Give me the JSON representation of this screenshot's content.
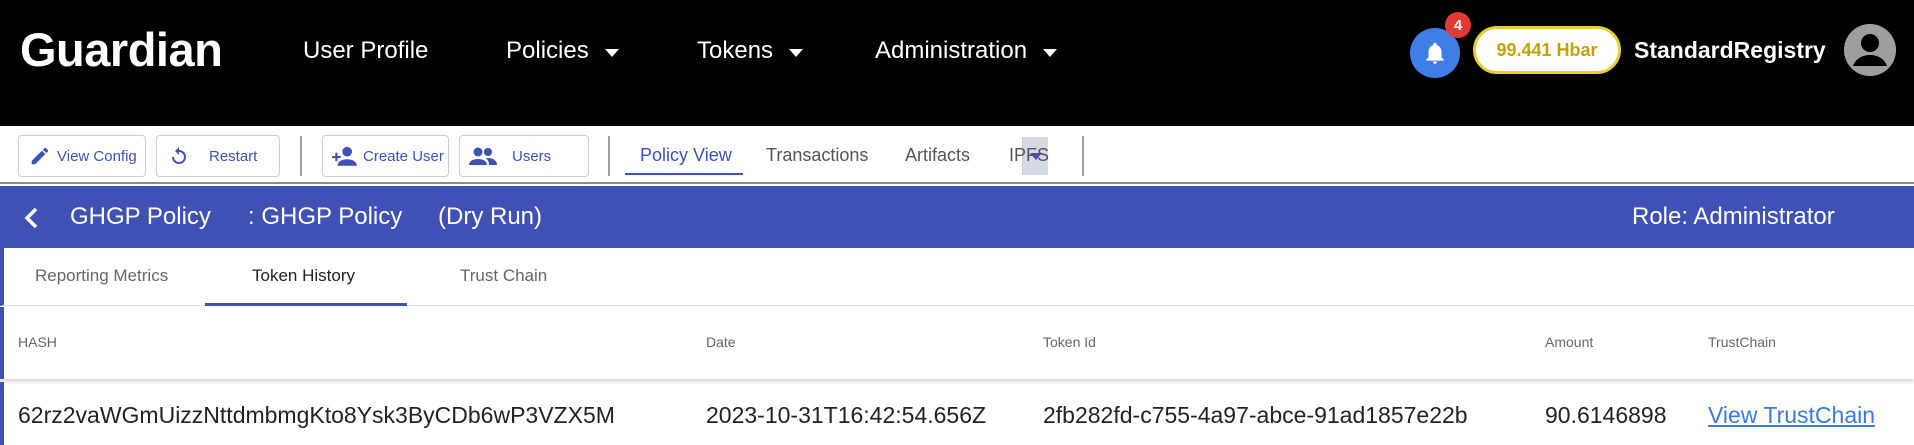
{
  "brand": "Guardian",
  "nav": {
    "user_profile": "User Profile",
    "policies": "Policies",
    "tokens": "Tokens",
    "administration": "Administration"
  },
  "notifications": {
    "count": "4",
    "icon": "bell-icon"
  },
  "balance": "99.441 Hbar",
  "user": {
    "name": "StandardRegistry",
    "icon": "account-circle-icon"
  },
  "toolbar": {
    "view_config": "View Config",
    "restart": "Restart",
    "create_user": "Create User",
    "users": "Users",
    "tabs": [
      "Policy View",
      "Transactions",
      "Artifacts",
      "IPFS"
    ],
    "active_tab": "Policy View"
  },
  "policy": {
    "name": "GHGP Policy",
    "subtitle": ": GHGP Policy",
    "mode": "(Dry Run)",
    "role": "Role: Administrator"
  },
  "tabs": {
    "items": [
      "Reporting Metrics",
      "Token History",
      "Trust Chain"
    ],
    "active": "Token History"
  },
  "table": {
    "columns": [
      "HASH",
      "Date",
      "Token Id",
      "Amount",
      "TrustChain"
    ],
    "rows": [
      {
        "hash": "62rz2vaWGmUizzNttdmbmgKto8Ysk3ByCDb6wP3VZX5M",
        "date": "2023-10-31T16:42:54.656Z",
        "token_id": "2fb282fd-c755-4a97-abce-91ad1857e22b",
        "amount": "90.6146898",
        "trustchain": "View TrustChain"
      }
    ]
  },
  "colors": {
    "navbar_bg": "#000000",
    "accent": "#3f51b5",
    "bell": "#3f7ee6",
    "badge": "#e53935",
    "balance_border": "#e8cf3a",
    "link": "#3a7bd5"
  }
}
